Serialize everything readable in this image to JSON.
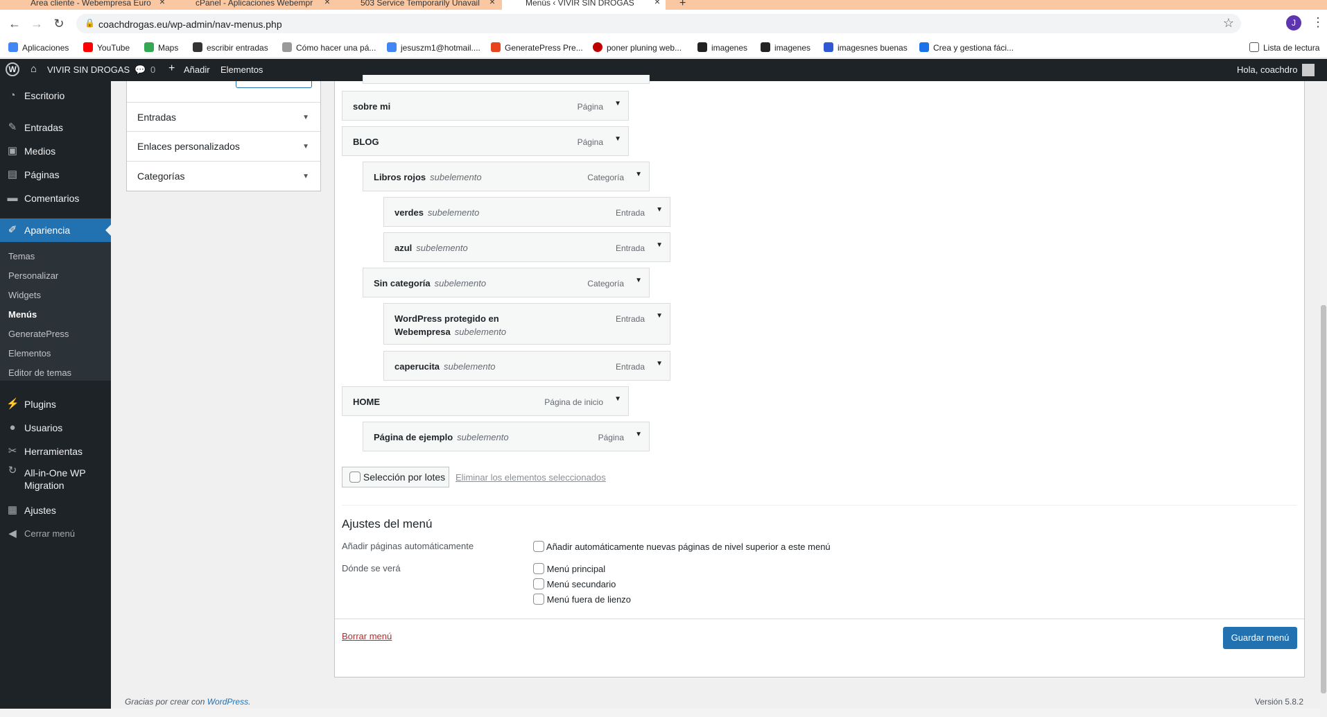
{
  "browser": {
    "tabs": [
      {
        "title": "Área cliente - Webempresa Euro",
        "active": false
      },
      {
        "title": "cPanel - Aplicaciones Webempr",
        "active": false
      },
      {
        "title": "503 Service Temporarily Unavail",
        "active": false
      },
      {
        "title": "Menús ‹ VIVIR SIN DROGAS",
        "active": true
      }
    ],
    "url": "coachdrogas.eu/wp-admin/nav-menus.php",
    "profile_initial": "J",
    "bookmarks": [
      {
        "label": "Aplicaciones",
        "color": "#4285f4"
      },
      {
        "label": "YouTube",
        "color": "#ff0000"
      },
      {
        "label": "Maps",
        "color": "#34a853"
      },
      {
        "label": "escribir entradas",
        "color": "#333333"
      },
      {
        "label": "Cómo hacer una pá...",
        "color": "#777777"
      },
      {
        "label": "jesuszm1@hotmail....",
        "color": "#4285f4"
      },
      {
        "label": "GeneratePress Pre...",
        "color": "#e8431e"
      },
      {
        "label": "poner pluning web...",
        "color": "#c00000"
      },
      {
        "label": "imagenes",
        "color": "#222222"
      },
      {
        "label": "imagenes",
        "color": "#222222"
      },
      {
        "label": "imagesnes buenas",
        "color": "#3057d4"
      },
      {
        "label": "Crea y gestiona fáci...",
        "color": "#1a73e8"
      }
    ],
    "reading_list": "Lista de lectura"
  },
  "adminbar": {
    "site_name": "VIVIR SIN DROGAS",
    "comments_count": "0",
    "add_new": "Añadir",
    "elements": "Elementos",
    "greeting": "Hola, coachdro"
  },
  "sidebar": {
    "items_top": [
      {
        "label": "Escritorio",
        "icon": "dashboard-icon"
      },
      {
        "label": "Entradas",
        "icon": "pin-icon"
      },
      {
        "label": "Medios",
        "icon": "media-icon"
      },
      {
        "label": "Páginas",
        "icon": "pages-icon"
      },
      {
        "label": "Comentarios",
        "icon": "comments-icon"
      },
      {
        "label": "Apariencia",
        "icon": "appearance-icon"
      }
    ],
    "submenu": [
      "Temas",
      "Personalizar",
      "Widgets",
      "Menús",
      "GeneratePress",
      "Elementos",
      "Editor de temas"
    ],
    "items_bottom": [
      {
        "label": "Plugins",
        "icon": "plugins-icon"
      },
      {
        "label": "Usuarios",
        "icon": "users-icon"
      },
      {
        "label": "Herramientas",
        "icon": "tools-icon"
      },
      {
        "label": "All-in-One WP",
        "label2": "Migration",
        "icon": "migration-icon"
      },
      {
        "label": "Ajustes",
        "icon": "settings-icon"
      },
      {
        "label": "Cerrar menú",
        "icon": "collapse-icon"
      }
    ]
  },
  "accordion": [
    "Entradas",
    "Enlaces personalizados",
    "Categorías"
  ],
  "menu_items": [
    {
      "title": "sobre mi",
      "sub": "",
      "type": "Página"
    },
    {
      "title": "BLOG",
      "sub": "",
      "type": "Página"
    },
    {
      "title": "Libros rojos",
      "sub": "subelemento",
      "type": "Categoría"
    },
    {
      "title": "verdes",
      "sub": "subelemento",
      "type": "Entrada"
    },
    {
      "title": "azul",
      "sub": "subelemento",
      "type": "Entrada"
    },
    {
      "title": "Sin categoría",
      "sub": "subelemento",
      "type": "Categoría"
    },
    {
      "title": "WordPress protegido en",
      "title2": "Webempresa",
      "sub": "subelemento",
      "type": "Entrada"
    },
    {
      "title": "caperucita",
      "sub": "subelemento",
      "type": "Entrada"
    },
    {
      "title": "HOME",
      "sub": "",
      "type": "Página de inicio"
    },
    {
      "title": "Página de ejemplo",
      "sub": "subelemento",
      "type": "Página"
    }
  ],
  "bulk": {
    "label": "Selección por lotes",
    "delete": "Eliminar los elementos seleccionados"
  },
  "settings": {
    "title": "Ajustes del menú",
    "auto_add_label": "Añadir páginas automáticamente",
    "auto_add_option": "Añadir automáticamente nuevas páginas de nivel superior a este menú",
    "location_label": "Dónde se verá",
    "locations": [
      "Menú principal",
      "Menú secundario",
      "Menú fuera de lienzo"
    ]
  },
  "actions": {
    "delete_menu": "Borrar menú",
    "save_menu": "Guardar menú"
  },
  "footer": {
    "thanks": "Gracias por crear con",
    "wp_link": "WordPress",
    "version": "Versión 5.8.2"
  }
}
